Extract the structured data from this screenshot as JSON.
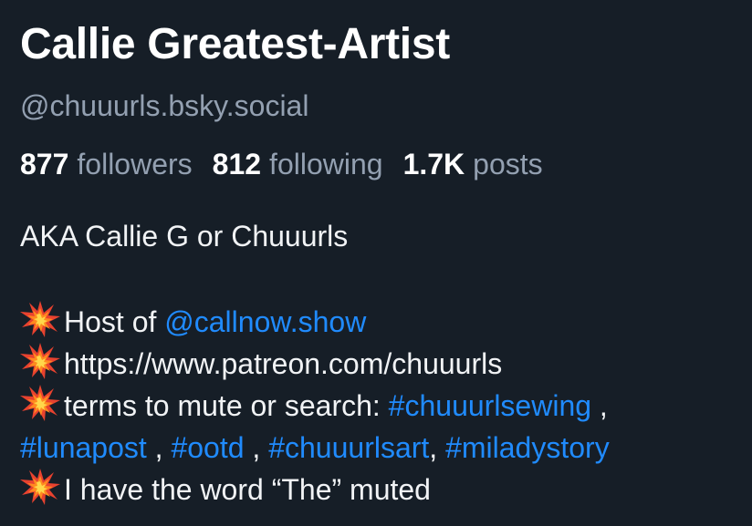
{
  "profile": {
    "display_name": "Callie Greatest-Artist",
    "handle": "@chuuurls.bsky.social",
    "stats": {
      "followers_count": "877",
      "followers_label": "followers",
      "following_count": "812",
      "following_label": "following",
      "posts_count": "1.7K",
      "posts_label": "posts"
    },
    "bio": {
      "line1": "AKA Callie G or Chuuurls",
      "host_prefix": "Host of ",
      "host_mention": "@callnow.show",
      "patreon_url": "https://www.patreon.com/chuuurls",
      "terms_prefix": "terms to mute or search: ",
      "tag_sewing": "#chuuurlsewing",
      "sep1": " ,",
      "tag_lunapost": "#lunapost",
      "sep2": " , ",
      "tag_ootd": "#ootd",
      "sep3": " , ",
      "tag_art": "#chuuurlsart",
      "sep4": ", ",
      "tag_miladystory": "#miladystory",
      "muted_line": "I have the word “The” muted"
    },
    "icons": {
      "bullet": "collision-emoji-icon"
    },
    "colors": {
      "background": "#161e27",
      "text": "#f1f3f5",
      "muted_text": "#93a0b1",
      "link": "#208bfe"
    }
  }
}
